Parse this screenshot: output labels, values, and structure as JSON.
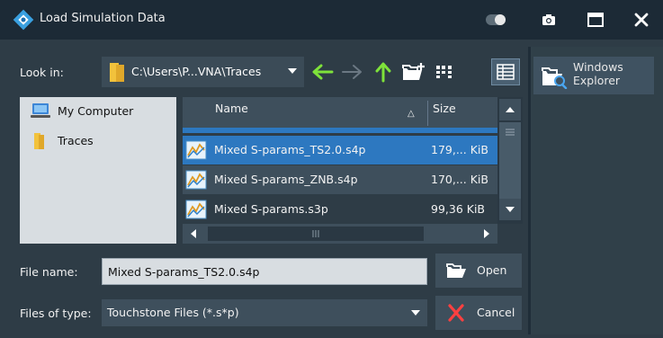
{
  "window": {
    "title": "Load Simulation Data"
  },
  "look_in": {
    "label": "Look in:",
    "path": "C:\\Users\\P...VNA\\Traces"
  },
  "right_panel": {
    "explorer_label_line1": "Windows",
    "explorer_label_line2": "Explorer"
  },
  "tree": {
    "items": [
      {
        "label": "My Computer",
        "icon": "computer-icon"
      },
      {
        "label": "Traces",
        "icon": "folder-icon"
      }
    ]
  },
  "files": {
    "columns": {
      "name": "Name",
      "size": "Size",
      "sort_indicator": "△"
    },
    "rows": [
      {
        "name": "Mixed S-params_TS2.0.s4p",
        "size": "179,... KiB",
        "selected": true
      },
      {
        "name": "Mixed S-params_ZNB.s4p",
        "size": "170,... KiB",
        "selected": false
      },
      {
        "name": "Mixed S-params.s3p",
        "size": "99,36 KiB",
        "selected": false
      }
    ]
  },
  "form": {
    "file_name_label": "File name:",
    "file_name_value": "Mixed S-params_TS2.0.s4p",
    "files_of_type_label": "Files of type:",
    "files_of_type_value": "Touchstone Files (*.s*p)"
  },
  "buttons": {
    "open": "Open",
    "cancel": "Cancel"
  },
  "colors": {
    "accent_green": "#7ee23a",
    "selection_blue": "#2d78c0",
    "cancel_red": "#ff4040",
    "folder_yellow": "#f2c23c"
  }
}
